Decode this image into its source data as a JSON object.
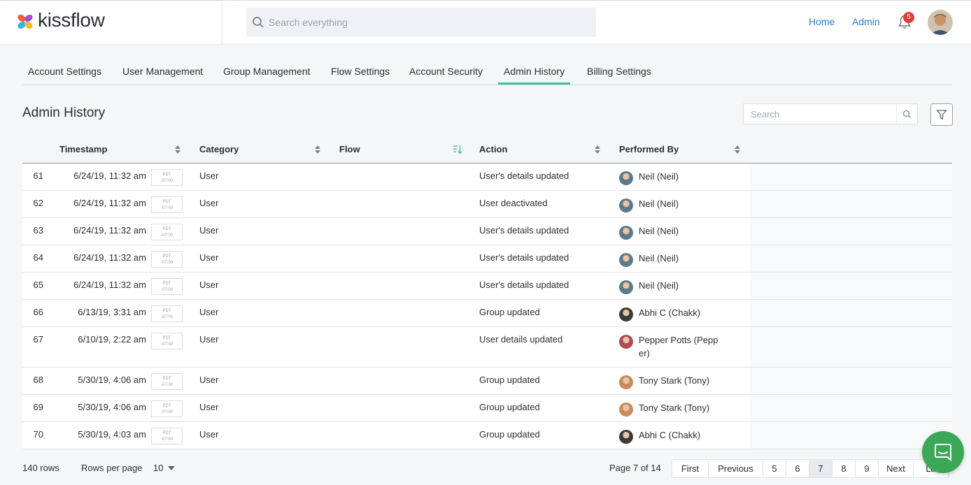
{
  "brand": {
    "name": "kissflow"
  },
  "header": {
    "search_placeholder": "Search everything",
    "nav": [
      "Home",
      "Admin"
    ],
    "notification_count": "5"
  },
  "tabs": [
    "Account Settings",
    "User Management",
    "Group Management",
    "Flow Settings",
    "Account Security",
    "Admin History",
    "Billing Settings"
  ],
  "active_tab": "Admin History",
  "page": {
    "title": "Admin History",
    "search_placeholder": "Search"
  },
  "table": {
    "columns": [
      "Timestamp",
      "Category",
      "Flow",
      "Action",
      "Performed By"
    ],
    "rows": [
      {
        "num": "61",
        "timestamp": "6/24/19, 11:32 am",
        "tz1": "PDT",
        "tz2": "-07:00",
        "category": "User",
        "flow": "",
        "action": "User's details updated",
        "by": "Neil (Neil)",
        "avatar": "neil"
      },
      {
        "num": "62",
        "timestamp": "6/24/19, 11:32 am",
        "tz1": "PDT",
        "tz2": "-07:00",
        "category": "User",
        "flow": "",
        "action": "User deactivated",
        "by": "Neil (Neil)",
        "avatar": "neil"
      },
      {
        "num": "63",
        "timestamp": "6/24/19, 11:32 am",
        "tz1": "PDT",
        "tz2": "-07:00",
        "category": "User",
        "flow": "",
        "action": "User's details updated",
        "by": "Neil (Neil)",
        "avatar": "neil"
      },
      {
        "num": "64",
        "timestamp": "6/24/19, 11:32 am",
        "tz1": "PDT",
        "tz2": "-07:00",
        "category": "User",
        "flow": "",
        "action": "User's details updated",
        "by": "Neil (Neil)",
        "avatar": "neil"
      },
      {
        "num": "65",
        "timestamp": "6/24/19, 11:32 am",
        "tz1": "PDT",
        "tz2": "-07:00",
        "category": "User",
        "flow": "",
        "action": "User's details updated",
        "by": "Neil (Neil)",
        "avatar": "neil"
      },
      {
        "num": "66",
        "timestamp": "6/13/19, 3:31 am",
        "tz1": "PDT",
        "tz2": "-07:00",
        "category": "User",
        "flow": "",
        "action": "Group updated",
        "by": "Abhi C (Chakk)",
        "avatar": "abhi"
      },
      {
        "num": "67",
        "timestamp": "6/10/19, 2:22 am",
        "tz1": "PDT",
        "tz2": "-07:00",
        "category": "User",
        "flow": "",
        "action": "User details updated",
        "by": "Pepper Potts (Pepp er)",
        "avatar": "pepper"
      },
      {
        "num": "68",
        "timestamp": "5/30/19, 4:06 am",
        "tz1": "PDT",
        "tz2": "-07:00",
        "category": "User",
        "flow": "",
        "action": "Group updated",
        "by": "Tony Stark (Tony)",
        "avatar": "tony"
      },
      {
        "num": "69",
        "timestamp": "5/30/19, 4:06 am",
        "tz1": "PDT",
        "tz2": "-07:00",
        "category": "User",
        "flow": "",
        "action": "Group updated",
        "by": "Tony Stark (Tony)",
        "avatar": "tony"
      },
      {
        "num": "70",
        "timestamp": "5/30/19, 4:03 am",
        "tz1": "PDT",
        "tz2": "-07:00",
        "category": "User",
        "flow": "",
        "action": "Group updated",
        "by": "Abhi C (Chakk)",
        "avatar": "abhi"
      }
    ]
  },
  "footer": {
    "row_count": "140 rows",
    "rows_per_page_label": "Rows per page",
    "rows_per_page_value": "10",
    "page_info": "Page 7 of 14",
    "pages": [
      "First",
      "Previous",
      "5",
      "6",
      "7",
      "8",
      "9",
      "Next",
      "La"
    ],
    "active_page": "7"
  },
  "colors": {
    "accent": "#3ec39a",
    "link": "#2a7bd6",
    "badge": "#e53935",
    "chat": "#3aa857",
    "avatars": {
      "neil": "#5d7a8c",
      "abhi": "#3a3a3a",
      "pepper": "#b24a5a",
      "tony": "#c98b5e"
    }
  }
}
